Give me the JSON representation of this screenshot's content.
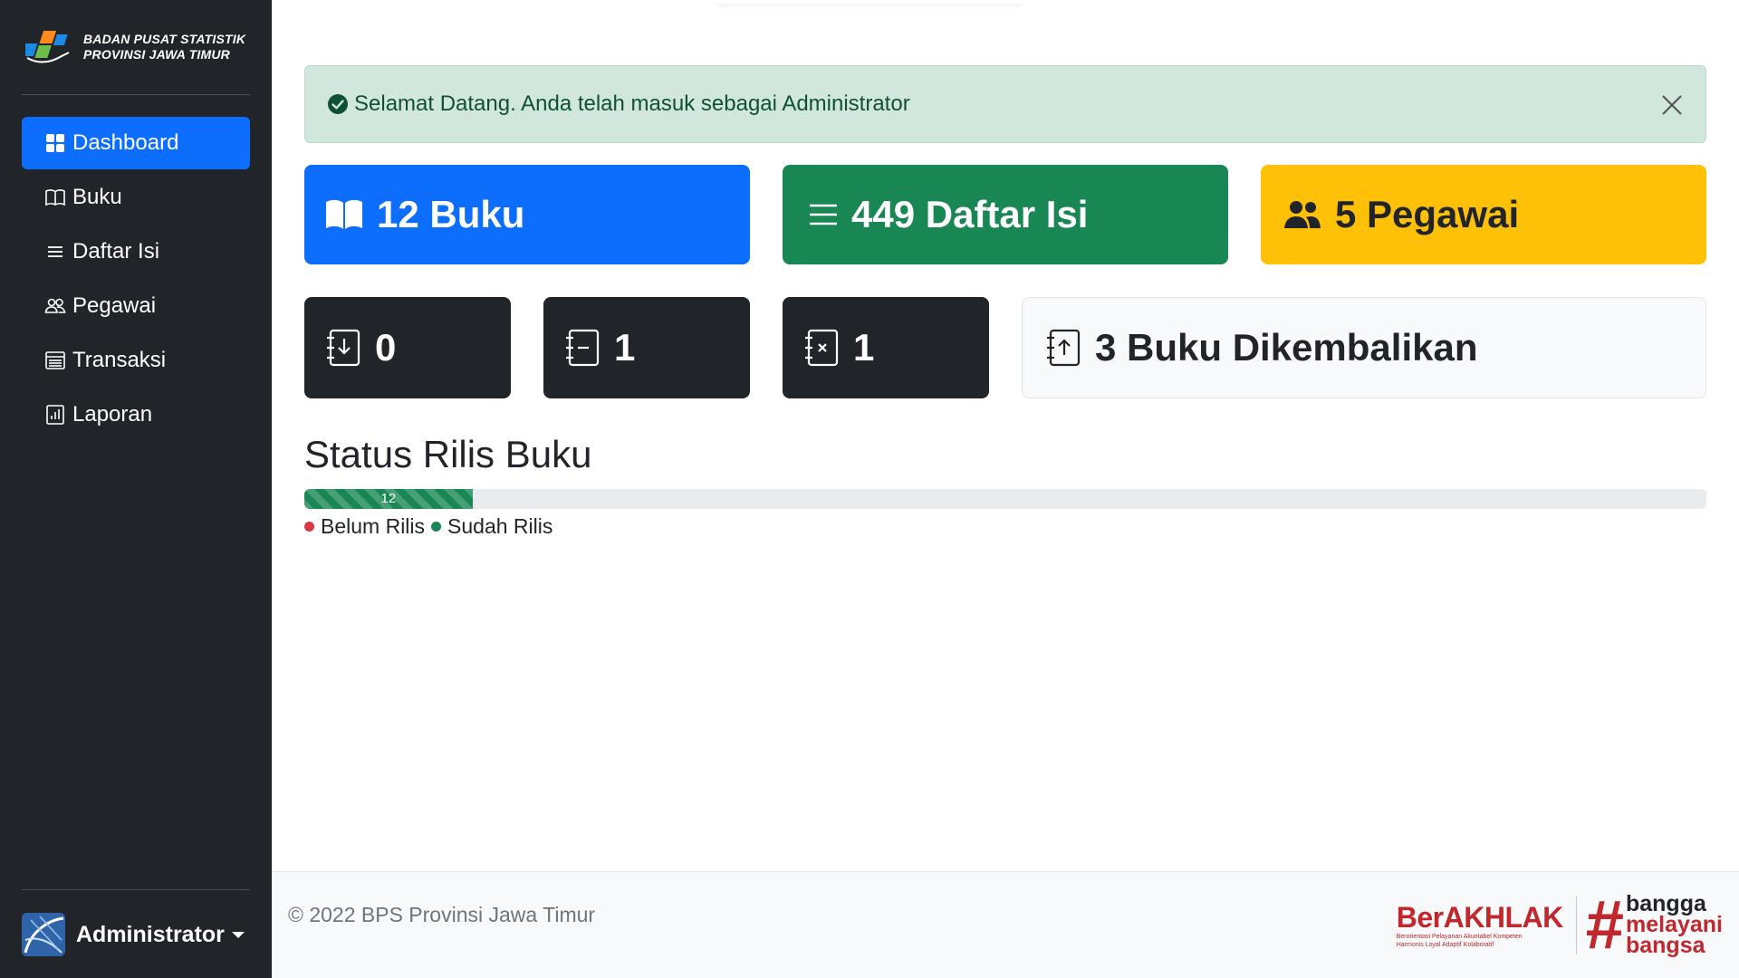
{
  "brand": {
    "line1": "BADAN PUSAT STATISTIK",
    "line2": "PROVINSI JAWA TIMUR"
  },
  "sidebar": {
    "items": [
      {
        "label": "Dashboard",
        "icon": "grid-icon",
        "active": true
      },
      {
        "label": "Buku",
        "icon": "book-icon"
      },
      {
        "label": "Daftar Isi",
        "icon": "list-icon"
      },
      {
        "label": "Pegawai",
        "icon": "people-icon"
      },
      {
        "label": "Transaksi",
        "icon": "transaction-icon"
      },
      {
        "label": "Laporan",
        "icon": "report-icon"
      }
    ]
  },
  "user": {
    "name": "Administrator"
  },
  "alert": {
    "message": "Selamat Datang. Anda telah masuk sebagai Administrator",
    "color": "#d1e7dd"
  },
  "stats": {
    "books": "12 Buku",
    "contents": "449 Daftar Isi",
    "employees": "5 Pegawai",
    "loan_in": "0",
    "loan_out": "1",
    "loan_cancel": "1",
    "returned": "3 Buku Dikembalikan"
  },
  "release_status": {
    "title": "Status Rilis Buku",
    "released_count": "12",
    "released_fraction": 0.12,
    "legend_unreleased": "Belum Rilis",
    "legend_released": "Sudah Rilis",
    "color_unreleased": "#dc3545",
    "color_released": "#198754"
  },
  "footer": {
    "copyright": "© 2022 BPS Provinsi Jawa Timur",
    "logo_berakhlak": "BerAKHLAK",
    "logo_berakhlak_sub": "Berorientasi Pelayanan Akuntabel Kompeten Harmonis Loyal Adaptif Kolaboratif",
    "logo_bangga_1": "bangga",
    "logo_bangga_2": "melayani",
    "logo_bangga_3": "bangsa"
  },
  "colors": {
    "primary": "#0d6efd",
    "success": "#198754",
    "warning": "#ffc107",
    "dark": "#212529"
  }
}
